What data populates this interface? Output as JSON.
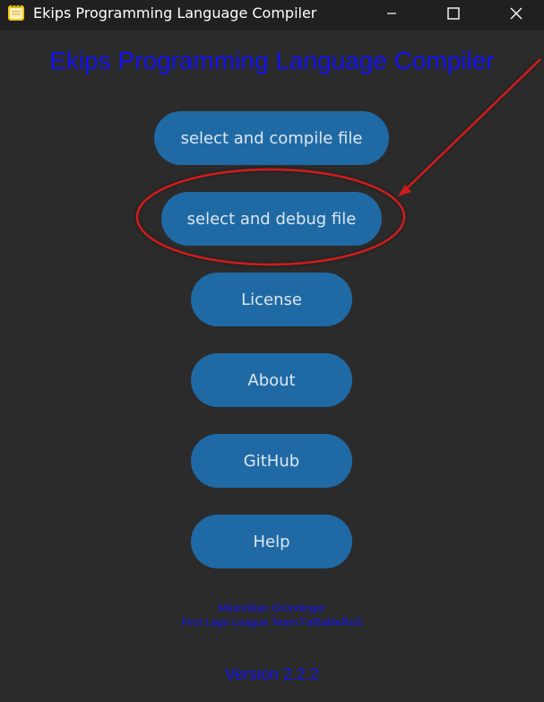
{
  "window": {
    "title": "Ekips Programming Language Compiler",
    "icon": "notepad-app-icon"
  },
  "app": {
    "title": "Ekips Programming Language Compiler",
    "title_color": "#1010f0",
    "button_color": "#1f6aa5",
    "background_color": "#2b2b2b"
  },
  "buttons": {
    "compile": "select and compile file",
    "debug": "select and debug file",
    "license": "License",
    "about": "About",
    "github": "GitHub",
    "help": "Help"
  },
  "credits": {
    "author": "Maximilian Gründinger",
    "team": "First Lego League Team FaRaMeRoS"
  },
  "version": "Version 2.2.2",
  "annotation": {
    "color": "#d01a1a",
    "target": "select and debug file"
  }
}
